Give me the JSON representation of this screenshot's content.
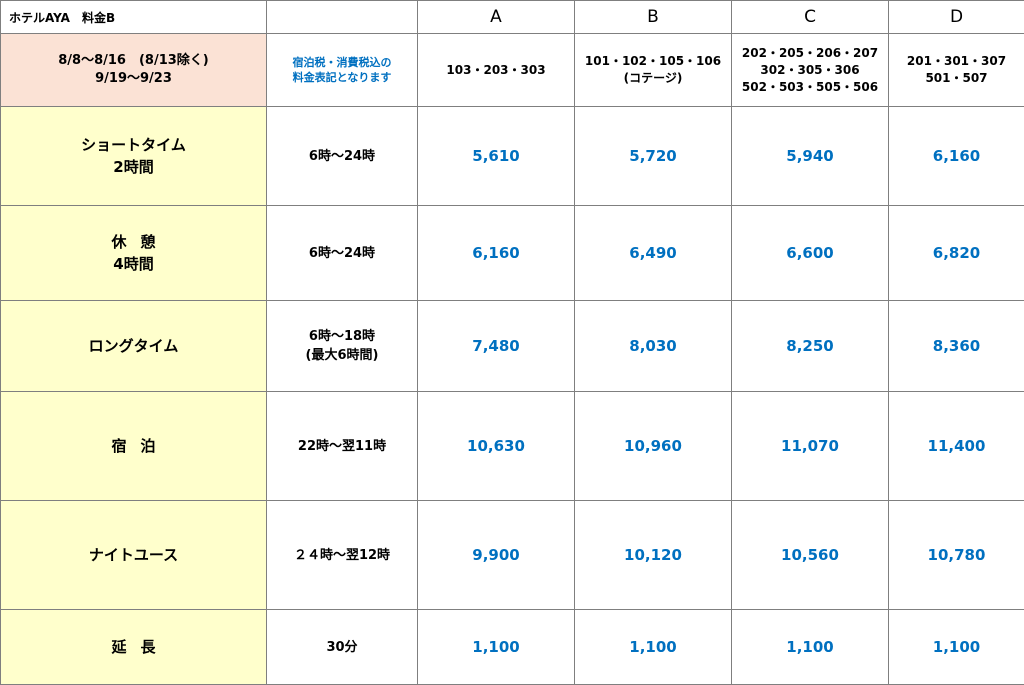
{
  "title": "ホテルAYA　料金B",
  "columns": [
    "A",
    "B",
    "C",
    "D"
  ],
  "period": {
    "line1": "8/8～8/16　(8/13除く)",
    "line2": "9/19～9/23"
  },
  "note": {
    "line1": "宿泊税・消費税込の",
    "line2": "料金表記となります"
  },
  "rooms": [
    {
      "lines": [
        "103・203・303"
      ]
    },
    {
      "lines": [
        "101・102・105・106",
        "(コテージ)"
      ]
    },
    {
      "lines": [
        "202・205・206・207",
        "302・305・306",
        "502・503・505・506"
      ]
    },
    {
      "lines": [
        "201・301・307",
        "501・507"
      ]
    }
  ],
  "plans": [
    {
      "id": "short",
      "name_lines": [
        "ショートタイム",
        "2時間"
      ],
      "time_lines": [
        "6時～24時"
      ],
      "prices": [
        "5,610",
        "5,720",
        "5,940",
        "6,160"
      ]
    },
    {
      "id": "rest",
      "name_lines": [
        "休憩",
        "4時間"
      ],
      "time_lines": [
        "6時～24時"
      ],
      "prices": [
        "6,160",
        "6,490",
        "6,600",
        "6,820"
      ]
    },
    {
      "id": "long",
      "name_lines": [
        "ロングタイム"
      ],
      "time_lines": [
        "6時～18時",
        "(最大6時間)"
      ],
      "prices": [
        "7,480",
        "8,030",
        "8,250",
        "8,360"
      ]
    },
    {
      "id": "stay",
      "name_lines": [
        "宿泊"
      ],
      "time_lines": [
        "22時～翌11時"
      ],
      "prices": [
        "10,630",
        "10,960",
        "11,070",
        "11,400"
      ]
    },
    {
      "id": "night",
      "name_lines": [
        "ナイトユース"
      ],
      "time_lines": [
        "２４時～翌12時"
      ],
      "prices": [
        "9,900",
        "10,120",
        "10,560",
        "10,780"
      ]
    },
    {
      "id": "ext",
      "name_lines": [
        "延長"
      ],
      "time_lines": [
        "30分"
      ],
      "prices": [
        "1,100",
        "1,100",
        "1,100",
        "1,100"
      ]
    }
  ],
  "colors": {
    "period_bg": "#fbe2d5",
    "plan_bg": "#ffffcc",
    "price_text": "#0070c0",
    "grid": "#7f7f7f"
  }
}
